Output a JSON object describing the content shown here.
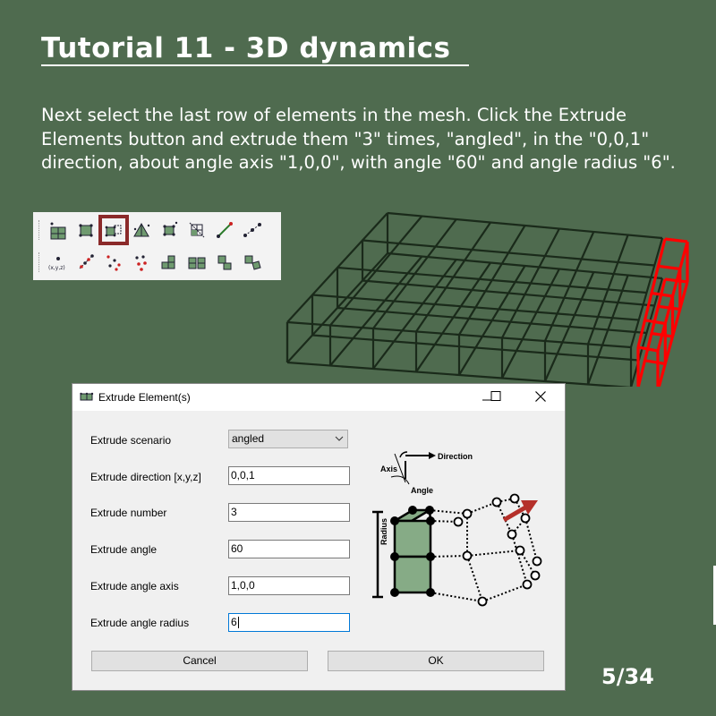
{
  "slide": {
    "title": "Tutorial 11 - 3D dynamics",
    "instructions": "Next select the last row of elements in the mesh. Click the Extrude Elements button and extrude them \"3\" times, \"angled\", in the \"0,0,1\" direction, about angle axis \"1,0,0\", with angle \"60\" and angle radius \"6\".",
    "page_number": "5/34"
  },
  "toolbar": {
    "row1": [
      "quad-mesh-icon",
      "element-icon",
      "extrude-elements-icon",
      "triangle-icon",
      "node-element-icon",
      "grid-icon",
      "line-icon",
      "nodes-line-icon"
    ],
    "row2": [
      "point-coord-icon",
      "diagonal-nodes-icon",
      "scatter-nodes-icon",
      "red-nodes-icon",
      "block-icon",
      "split-block-icon",
      "stair-icon",
      "rotate-block-icon"
    ],
    "point_label": "(x,y,z)",
    "selected": "extrude-elements-icon"
  },
  "dialog": {
    "title": "Extrude Element(s)",
    "fields": [
      {
        "label": "Extrude scenario",
        "value": "angled"
      },
      {
        "label": "Extrude direction [x,y,z]",
        "value": "0,0,1"
      },
      {
        "label": "Extrude number",
        "value": "3"
      },
      {
        "label": "Extrude angle",
        "value": "60"
      },
      {
        "label": "Extrude angle axis",
        "value": "1,0,0"
      },
      {
        "label": "Extrude angle radius",
        "value": "6"
      }
    ],
    "cancel_label": "Cancel",
    "ok_label": "OK",
    "diagram": {
      "direction_label": "Direction",
      "axis_label": "Axis",
      "angle_label": "Angle",
      "radius_label": "Radius"
    }
  },
  "colors": {
    "background": "#4f6b4f",
    "mesh": "#1a2a1a",
    "selected_row": "#ff0000",
    "toolbar_highlight": "#8b2a2a",
    "element_fill": "#86ab86"
  }
}
